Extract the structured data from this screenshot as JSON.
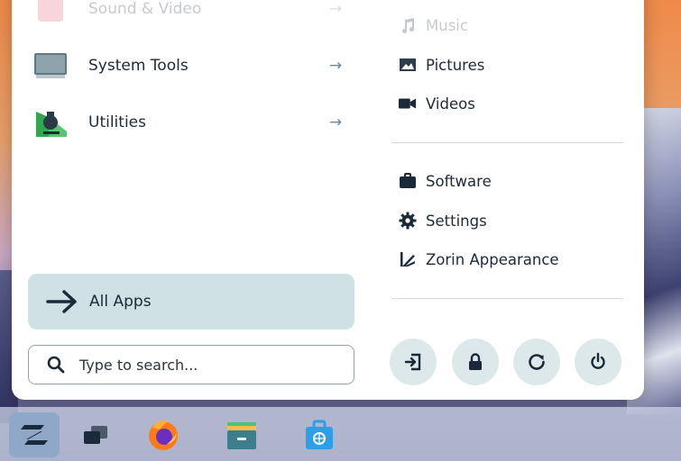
{
  "menu": {
    "apps": [
      {
        "label": "Sound & Video",
        "icon": "music-note-app-icon",
        "arrow": "→"
      },
      {
        "label": "System Tools",
        "icon": "monitor-icon",
        "arrow": "→"
      },
      {
        "label": "Utilities",
        "icon": "utilities-icon",
        "arrow": "→"
      }
    ],
    "all_apps_label": "All Apps",
    "search": {
      "placeholder": "Type to search..."
    },
    "places": [
      {
        "label": "Music",
        "icon": "music-icon"
      },
      {
        "label": "Pictures",
        "icon": "picture-icon"
      },
      {
        "label": "Videos",
        "icon": "video-camera-icon"
      },
      {
        "label": "Software",
        "icon": "briefcase-icon"
      },
      {
        "label": "Settings",
        "icon": "gear-icon"
      },
      {
        "label": "Zorin Appearance",
        "icon": "zorin-appearance-icon"
      }
    ],
    "system_buttons": [
      "logout-icon",
      "lock-icon",
      "restart-icon",
      "power-icon"
    ]
  },
  "taskbar": {
    "items": [
      "zorin-menu-icon",
      "workspaces-icon",
      "firefox-icon",
      "files-icon",
      "software-store-icon"
    ]
  },
  "colors": {
    "accent": "#cfe1e4",
    "text": "#1b2a3a",
    "panel": "#ffffff"
  }
}
